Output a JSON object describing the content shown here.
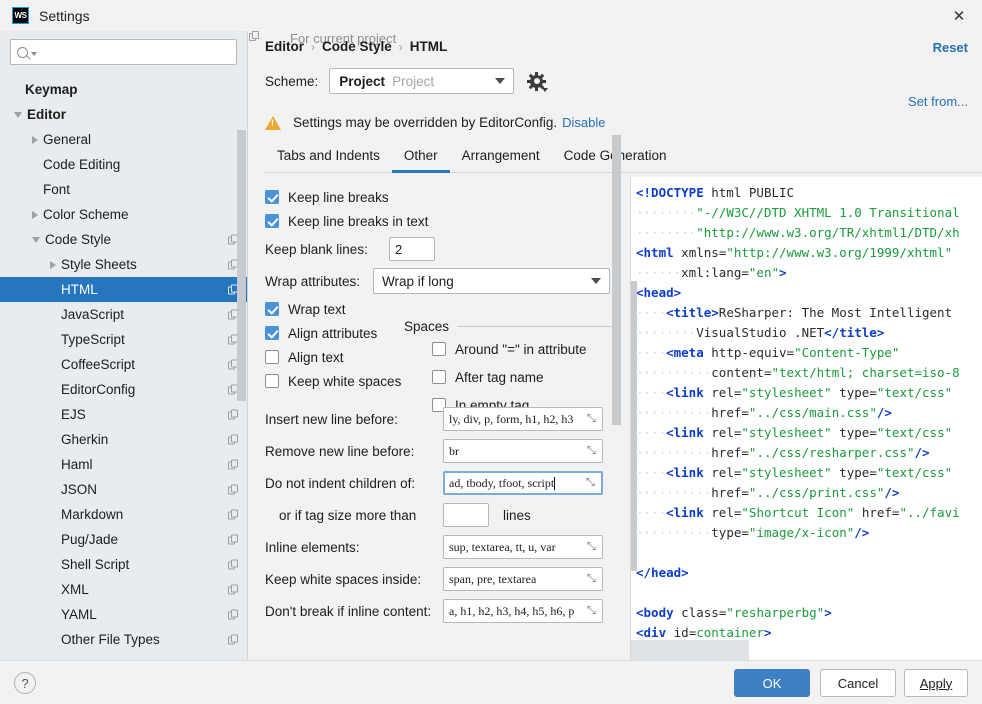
{
  "window": {
    "title": "Settings",
    "app_icon": "webstorm-icon",
    "close_icon": "close-icon"
  },
  "search": {
    "value": "",
    "placeholder": "",
    "icon": "search-icon"
  },
  "sidebar": {
    "items": [
      {
        "label": "Keymap",
        "depth": 0,
        "arrow": "none",
        "bold": true,
        "copy": false,
        "selected": false
      },
      {
        "label": "Editor",
        "depth": 0,
        "arrow": "down",
        "bold": true,
        "copy": false,
        "selected": false
      },
      {
        "label": "General",
        "depth": 1,
        "arrow": "right",
        "bold": false,
        "copy": false,
        "selected": false
      },
      {
        "label": "Code Editing",
        "depth": 1,
        "arrow": "none",
        "bold": false,
        "copy": false,
        "selected": false
      },
      {
        "label": "Font",
        "depth": 1,
        "arrow": "none",
        "bold": false,
        "copy": false,
        "selected": false
      },
      {
        "label": "Color Scheme",
        "depth": 1,
        "arrow": "right",
        "bold": false,
        "copy": false,
        "selected": false
      },
      {
        "label": "Code Style",
        "depth": 1,
        "arrow": "down",
        "bold": false,
        "copy": true,
        "selected": false
      },
      {
        "label": "Style Sheets",
        "depth": 2,
        "arrow": "right",
        "bold": false,
        "copy": true,
        "selected": false
      },
      {
        "label": "HTML",
        "depth": 2,
        "arrow": "none",
        "bold": false,
        "copy": true,
        "selected": true
      },
      {
        "label": "JavaScript",
        "depth": 2,
        "arrow": "none",
        "bold": false,
        "copy": true,
        "selected": false
      },
      {
        "label": "TypeScript",
        "depth": 2,
        "arrow": "none",
        "bold": false,
        "copy": true,
        "selected": false
      },
      {
        "label": "CoffeeScript",
        "depth": 2,
        "arrow": "none",
        "bold": false,
        "copy": true,
        "selected": false
      },
      {
        "label": "EditorConfig",
        "depth": 2,
        "arrow": "none",
        "bold": false,
        "copy": true,
        "selected": false
      },
      {
        "label": "EJS",
        "depth": 2,
        "arrow": "none",
        "bold": false,
        "copy": true,
        "selected": false
      },
      {
        "label": "Gherkin",
        "depth": 2,
        "arrow": "none",
        "bold": false,
        "copy": true,
        "selected": false
      },
      {
        "label": "Haml",
        "depth": 2,
        "arrow": "none",
        "bold": false,
        "copy": true,
        "selected": false
      },
      {
        "label": "JSON",
        "depth": 2,
        "arrow": "none",
        "bold": false,
        "copy": true,
        "selected": false
      },
      {
        "label": "Markdown",
        "depth": 2,
        "arrow": "none",
        "bold": false,
        "copy": true,
        "selected": false
      },
      {
        "label": "Pug/Jade",
        "depth": 2,
        "arrow": "none",
        "bold": false,
        "copy": true,
        "selected": false
      },
      {
        "label": "Shell Script",
        "depth": 2,
        "arrow": "none",
        "bold": false,
        "copy": true,
        "selected": false
      },
      {
        "label": "XML",
        "depth": 2,
        "arrow": "none",
        "bold": false,
        "copy": true,
        "selected": false
      },
      {
        "label": "YAML",
        "depth": 2,
        "arrow": "none",
        "bold": false,
        "copy": true,
        "selected": false
      },
      {
        "label": "Other File Types",
        "depth": 2,
        "arrow": "none",
        "bold": false,
        "copy": true,
        "selected": false
      }
    ]
  },
  "header": {
    "breadcrumb": [
      "Editor",
      "Code Style",
      "HTML"
    ],
    "separator": "›",
    "for_current_project": "For current project",
    "reset_label": "Reset",
    "set_from_label": "Set from...",
    "scheme_label": "Scheme:",
    "scheme_value": "Project",
    "scheme_qualifier": "Project",
    "gear_icon": "gear-icon",
    "warning_icon": "warning-icon",
    "warning_text": "Settings may be overridden by EditorConfig.",
    "warning_link": "Disable"
  },
  "tabs": [
    {
      "label": "Tabs and Indents",
      "active": false
    },
    {
      "label": "Other",
      "active": true
    },
    {
      "label": "Arrangement",
      "active": false
    },
    {
      "label": "Code Generation",
      "active": false
    }
  ],
  "settings": {
    "checkboxes_left": [
      {
        "label": "Keep line breaks",
        "checked": true
      },
      {
        "label": "Keep line breaks in text",
        "checked": true
      }
    ],
    "keep_blank_lines": {
      "label": "Keep blank lines:",
      "value": "2"
    },
    "wrap_attributes": {
      "label": "Wrap attributes:",
      "value": "Wrap if long"
    },
    "checkboxes_wrap": [
      {
        "label": "Wrap text",
        "checked": true
      },
      {
        "label": "Align attributes",
        "checked": true
      },
      {
        "label": "Align text",
        "checked": false
      },
      {
        "label": "Keep white spaces",
        "checked": false
      }
    ],
    "spaces": {
      "title": "Spaces",
      "items": [
        {
          "label": "Around \"=\" in attribute",
          "checked": false
        },
        {
          "label": "After tag name",
          "checked": false
        },
        {
          "label": "In empty tag",
          "checked": false
        }
      ]
    },
    "fields": [
      {
        "label": "Insert new line before:",
        "value": "ly, div, p, form, h1, h2, h3",
        "focused": false
      },
      {
        "label": "Remove new line before:",
        "value": "br",
        "focused": false
      },
      {
        "label": "Do not indent children of:",
        "value": "ad, tbody, tfoot, script",
        "focused": true
      },
      {
        "label": "Inline elements:",
        "value": "sup, textarea, tt, u, var",
        "focused": false
      },
      {
        "label": "Keep white spaces inside:",
        "value": "span, pre, textarea",
        "focused": false
      },
      {
        "label": "Don't break if inline content:",
        "value": "a, h1, h2, h3, h4, h5, h6, p",
        "focused": false
      }
    ],
    "tag_size": {
      "label": "or if tag size more than",
      "value": "",
      "suffix": "lines"
    }
  },
  "preview": {
    "lines": [
      [
        {
          "t": "tg",
          "s": "<!DOCTYPE"
        },
        {
          "t": "pl",
          "s": " html PUBLIC"
        }
      ],
      [
        {
          "t": "ws",
          "s": "········"
        },
        {
          "t": "av",
          "s": "\"-//W3C//DTD XHTML 1.0 Transitional"
        }
      ],
      [
        {
          "t": "ws",
          "s": "········"
        },
        {
          "t": "av",
          "s": "\"http://www.w3.org/TR/xhtml1/DTD/xh"
        }
      ],
      [
        {
          "t": "tg",
          "s": "<html"
        },
        {
          "t": "pl",
          "s": " "
        },
        {
          "t": "an",
          "s": "xmlns"
        },
        {
          "t": "pl",
          "s": "="
        },
        {
          "t": "av",
          "s": "\"http://www.w3.org/1999/xhtml\""
        }
      ],
      [
        {
          "t": "ws",
          "s": "······"
        },
        {
          "t": "an",
          "s": "xml:lang"
        },
        {
          "t": "pl",
          "s": "="
        },
        {
          "t": "av",
          "s": "\"en\""
        },
        {
          "t": "tg",
          "s": ">"
        }
      ],
      [
        {
          "t": "tg",
          "s": "<head>"
        }
      ],
      [
        {
          "t": "ws",
          "s": "····"
        },
        {
          "t": "tg",
          "s": "<title>"
        },
        {
          "t": "pl",
          "s": "ReSharper: The Most Intelligent"
        }
      ],
      [
        {
          "t": "ws",
          "s": "········"
        },
        {
          "t": "pl",
          "s": "VisualStudio .NET"
        },
        {
          "t": "tg",
          "s": "</title>"
        }
      ],
      [
        {
          "t": "ws",
          "s": "····"
        },
        {
          "t": "tg",
          "s": "<meta"
        },
        {
          "t": "pl",
          "s": " "
        },
        {
          "t": "an",
          "s": "http-equiv"
        },
        {
          "t": "pl",
          "s": "="
        },
        {
          "t": "av",
          "s": "\"Content-Type\""
        }
      ],
      [
        {
          "t": "ws",
          "s": "··········"
        },
        {
          "t": "an",
          "s": "content"
        },
        {
          "t": "pl",
          "s": "="
        },
        {
          "t": "av",
          "s": "\"text/html; charset=iso-8"
        }
      ],
      [
        {
          "t": "ws",
          "s": "····"
        },
        {
          "t": "tg",
          "s": "<link"
        },
        {
          "t": "pl",
          "s": " "
        },
        {
          "t": "an",
          "s": "rel"
        },
        {
          "t": "pl",
          "s": "="
        },
        {
          "t": "av",
          "s": "\"stylesheet\""
        },
        {
          "t": "pl",
          "s": " "
        },
        {
          "t": "an",
          "s": "type"
        },
        {
          "t": "pl",
          "s": "="
        },
        {
          "t": "av",
          "s": "\"text/css\""
        }
      ],
      [
        {
          "t": "ws",
          "s": "··········"
        },
        {
          "t": "an",
          "s": "href"
        },
        {
          "t": "pl",
          "s": "="
        },
        {
          "t": "av",
          "s": "\"../css/main.css\""
        },
        {
          "t": "tg",
          "s": "/>"
        }
      ],
      [
        {
          "t": "ws",
          "s": "····"
        },
        {
          "t": "tg",
          "s": "<link"
        },
        {
          "t": "pl",
          "s": " "
        },
        {
          "t": "an",
          "s": "rel"
        },
        {
          "t": "pl",
          "s": "="
        },
        {
          "t": "av",
          "s": "\"stylesheet\""
        },
        {
          "t": "pl",
          "s": " "
        },
        {
          "t": "an",
          "s": "type"
        },
        {
          "t": "pl",
          "s": "="
        },
        {
          "t": "av",
          "s": "\"text/css\""
        }
      ],
      [
        {
          "t": "ws",
          "s": "··········"
        },
        {
          "t": "an",
          "s": "href"
        },
        {
          "t": "pl",
          "s": "="
        },
        {
          "t": "av",
          "s": "\"../css/resharper.css\""
        },
        {
          "t": "tg",
          "s": "/>"
        }
      ],
      [
        {
          "t": "ws",
          "s": "····"
        },
        {
          "t": "tg",
          "s": "<link"
        },
        {
          "t": "pl",
          "s": " "
        },
        {
          "t": "an",
          "s": "rel"
        },
        {
          "t": "pl",
          "s": "="
        },
        {
          "t": "av",
          "s": "\"stylesheet\""
        },
        {
          "t": "pl",
          "s": " "
        },
        {
          "t": "an",
          "s": "type"
        },
        {
          "t": "pl",
          "s": "="
        },
        {
          "t": "av",
          "s": "\"text/css\""
        }
      ],
      [
        {
          "t": "ws",
          "s": "··········"
        },
        {
          "t": "an",
          "s": "href"
        },
        {
          "t": "pl",
          "s": "="
        },
        {
          "t": "av",
          "s": "\"../css/print.css\""
        },
        {
          "t": "tg",
          "s": "/>"
        }
      ],
      [
        {
          "t": "ws",
          "s": "····"
        },
        {
          "t": "tg",
          "s": "<link"
        },
        {
          "t": "pl",
          "s": " "
        },
        {
          "t": "an",
          "s": "rel"
        },
        {
          "t": "pl",
          "s": "="
        },
        {
          "t": "av",
          "s": "\"Shortcut Icon\""
        },
        {
          "t": "pl",
          "s": " "
        },
        {
          "t": "an",
          "s": "href"
        },
        {
          "t": "pl",
          "s": "="
        },
        {
          "t": "av",
          "s": "\"../favi"
        }
      ],
      [
        {
          "t": "ws",
          "s": "··········"
        },
        {
          "t": "an",
          "s": "type"
        },
        {
          "t": "pl",
          "s": "="
        },
        {
          "t": "av",
          "s": "\"image/x-icon\""
        },
        {
          "t": "tg",
          "s": "/>"
        }
      ],
      [],
      [
        {
          "t": "tg",
          "s": "</head>"
        }
      ],
      [],
      [
        {
          "t": "tg",
          "s": "<body"
        },
        {
          "t": "pl",
          "s": " "
        },
        {
          "t": "an",
          "s": "class"
        },
        {
          "t": "pl",
          "s": "="
        },
        {
          "t": "av",
          "s": "\"resharperbg\""
        },
        {
          "t": "tg",
          "s": ">"
        }
      ],
      [
        {
          "t": "tg",
          "s": "<div"
        },
        {
          "t": "pl",
          "s": " "
        },
        {
          "t": "an",
          "s": "id"
        },
        {
          "t": "pl",
          "s": "="
        },
        {
          "t": "av",
          "s": "container"
        },
        {
          "t": "tg",
          "s": ">"
        }
      ]
    ]
  },
  "footer": {
    "help_label": "?",
    "ok_label": "OK",
    "cancel_label": "Cancel",
    "apply_label": "Apply"
  },
  "colors": {
    "accent": "#2675bf",
    "primary_button": "#3d80c4",
    "link": "#2470b3",
    "highlight_box": "#e60000",
    "checkbox_on": "#4a93d8",
    "tag": "#0c3ccc",
    "attr_value": "#1a9b3c",
    "warning": "#f0a732"
  }
}
